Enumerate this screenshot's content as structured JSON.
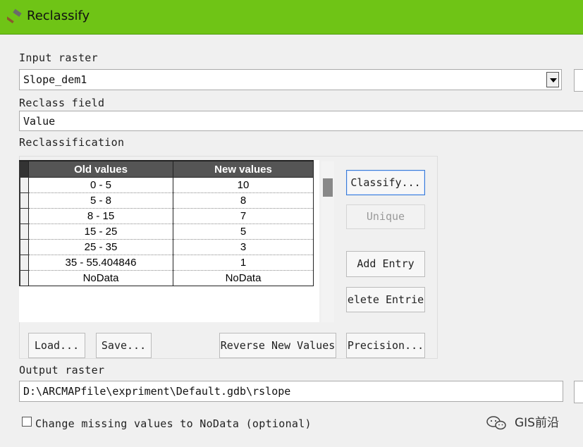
{
  "window": {
    "title": "Reclassify",
    "title_icon": "hammer-icon",
    "accent_color": "#6fc416"
  },
  "input_raster": {
    "label": "Input raster",
    "value": "Slope_dem1"
  },
  "reclass_field": {
    "label": "Reclass field",
    "value": "Value"
  },
  "reclassification": {
    "label": "Reclassification",
    "columns": [
      "Old values",
      "New values"
    ],
    "rows": [
      [
        "0 - 5",
        "10"
      ],
      [
        "5 - 8",
        "8"
      ],
      [
        "8 - 15",
        "7"
      ],
      [
        "15 - 25",
        "5"
      ],
      [
        "25 - 35",
        "3"
      ],
      [
        "35 - 55.404846",
        "1"
      ],
      [
        "NoData",
        "NoData"
      ]
    ]
  },
  "buttons": {
    "classify": "Classify...",
    "unique": "Unique",
    "add_entry": "Add Entry",
    "delete_entries": "elete Entrie",
    "load": "Load...",
    "save": "Save...",
    "reverse": "Reverse New Values",
    "precision": "Precision..."
  },
  "output_raster": {
    "label": "Output raster",
    "value": "D:\\ARCMAPfile\\expriment\\Default.gdb\\rslope"
  },
  "missing_values": {
    "label": "Change missing values to NoData (optional)",
    "checked": false
  },
  "watermark": {
    "text": "GIS前沿",
    "icon": "wechat-icon"
  }
}
